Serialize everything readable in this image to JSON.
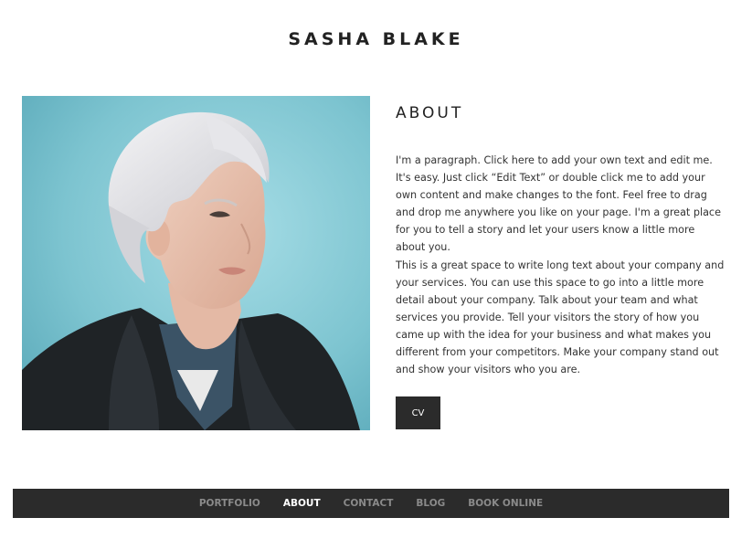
{
  "header": {
    "site_title": "SASHA BLAKE"
  },
  "about": {
    "heading": "ABOUT",
    "paragraph_1": "I'm a paragraph. Click here to add your own text and edit me. It's easy. Just click “Edit Text” or double click me to add your own content and make changes to the font. Feel free to drag and drop me anywhere you like on your page. I'm a great place for you to tell a story and let your users know a little more about you.",
    "paragraph_2": "This is a great space to write long text about your company and your services. You can use this space to go into a little more detail about your company. Talk about your team and what services you provide. Tell your visitors the story of how you came up with the idea for your business and what makes you different from your competitors. Make your company stand out and show your visitors who you are.",
    "cv_button_label": "CV"
  },
  "nav": {
    "items": [
      {
        "label": "PORTFOLIO",
        "active": false
      },
      {
        "label": "ABOUT",
        "active": true
      },
      {
        "label": "CONTACT",
        "active": false
      },
      {
        "label": "BLOG",
        "active": false
      },
      {
        "label": "BOOK ONLINE",
        "active": false
      }
    ]
  },
  "colors": {
    "dark_bar": "#2b2b2b",
    "nav_inactive": "#8a8a8a",
    "nav_active": "#ffffff",
    "photo_background": "#8fd0db"
  }
}
